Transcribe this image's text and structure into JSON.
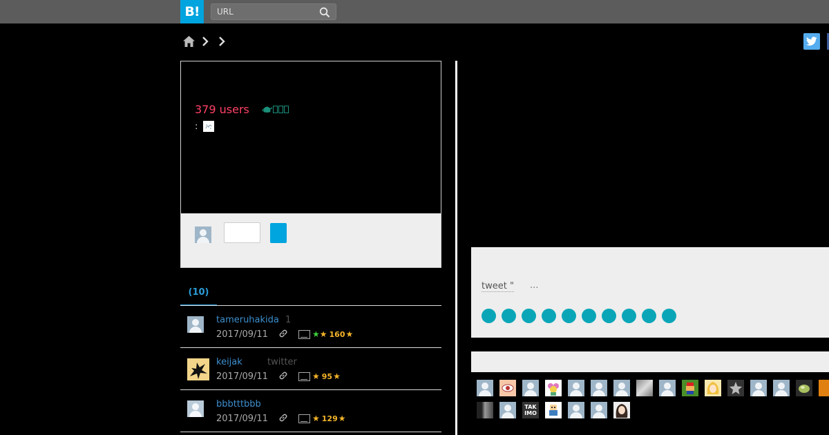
{
  "header": {
    "logo_text": "B!",
    "search_placeholder": "URL"
  },
  "entry": {
    "users_count": "379 users",
    "colon": ":"
  },
  "tabs": [
    {
      "label": "(10)"
    }
  ],
  "bookmarks": [
    {
      "user": "tameruhakida",
      "tag": "1",
      "date": "2017/09/11",
      "green_star": true,
      "star_count": "160",
      "avatar": "default"
    },
    {
      "user": "keijak",
      "tag": "twitter",
      "date": "2017/09/11",
      "green_star": false,
      "star_count": "95",
      "avatar": "yellow"
    },
    {
      "user": "bbbtttbbb",
      "tag": "",
      "date": "2017/09/11",
      "green_star": false,
      "star_count": "129",
      "avatar": "default"
    }
  ],
  "tweet": {
    "label": "tweet \"",
    "ellipsis": "..."
  },
  "avatars_row1": [
    "default",
    "eye",
    "default",
    "flower",
    "default",
    "default",
    "default",
    "cat",
    "default",
    "mario",
    "blonde",
    "star",
    "default",
    "default",
    "leaf",
    "orange"
  ],
  "avatars_row2": [
    "dark",
    "default",
    "takimo",
    "robot",
    "default",
    "default",
    "girl"
  ],
  "takimo_text": "TAK\nIMO",
  "colors": {
    "brand": "#00a4de",
    "users_red": "#ff4166",
    "link_blue": "#3d8fcf",
    "star_yellow": "#f5b42a",
    "dot_teal": "#0aa6b8"
  }
}
